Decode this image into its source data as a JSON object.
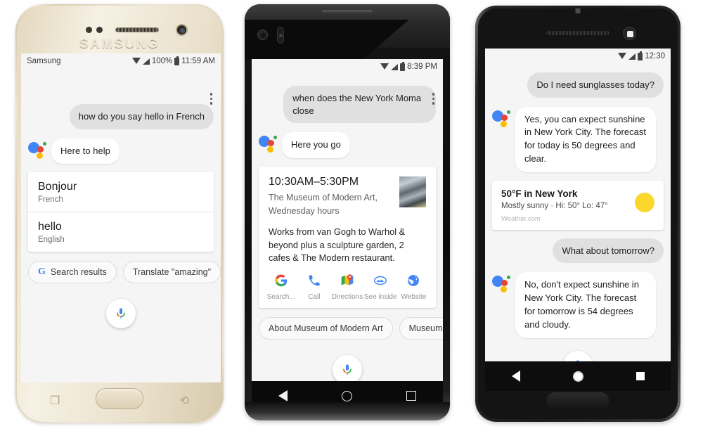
{
  "phones": {
    "left": {
      "device_label": "SAMSUNG",
      "statusbar": {
        "carrier": "Samsung",
        "battery": "100%",
        "time": "11:59 AM"
      },
      "conversation": {
        "user_query": "how do you say hello in French",
        "assistant_reply": "Here to help"
      },
      "translation_card": [
        {
          "word": "Bonjour",
          "language": "French"
        },
        {
          "word": "hello",
          "language": "English"
        }
      ],
      "chips": [
        {
          "icon": "google-g-icon",
          "label": "Search results"
        },
        {
          "icon": "",
          "label": "Translate \"amazing\""
        }
      ],
      "mic_label": "microphone"
    },
    "middle": {
      "statusbar": {
        "time": "8:39 PM"
      },
      "conversation": {
        "user_query": "when does the New York Moma close",
        "assistant_reply": "Here you go"
      },
      "place_card": {
        "hours": "10:30AM–5:30PM",
        "name": "The Museum of Modern Art,",
        "day_hours": "Wednesday hours",
        "description": "Works from van Gogh to Warhol & beyond plus a sculpture garden, 2 cafes & The Modern restaurant.",
        "actions": [
          {
            "icon": "google-g-icon",
            "label": "Search..."
          },
          {
            "icon": "phone-icon",
            "label": "Call"
          },
          {
            "icon": "maps-pin-icon",
            "label": "Directions"
          },
          {
            "icon": "see-inside-icon",
            "label": "See inside"
          },
          {
            "icon": "globe-icon",
            "label": "Website"
          }
        ]
      },
      "chips": [
        {
          "label": "About Museum of Modern Art"
        },
        {
          "label": "Museums i"
        }
      ],
      "mic_label": "microphone",
      "nav": {
        "back": "back",
        "home": "home",
        "recents": "recents"
      }
    },
    "right": {
      "statusbar": {
        "time": "12:30"
      },
      "conversation": [
        {
          "role": "user",
          "text": "Do I need sunglasses today?"
        },
        {
          "role": "assistant",
          "text": "Yes, you can expect sunshine in New York City. The forecast for today is 50 degrees and clear."
        },
        {
          "role": "user",
          "text": "What about tomorrow?"
        },
        {
          "role": "assistant",
          "text": "No, don't expect sunshine in New York City. The forecast for tomorrow is 54 degrees and cloudy."
        }
      ],
      "weather_card": {
        "title": "50°F in New York",
        "subtitle": "Mostly sunny · Hi: 50° Lo: 47°",
        "source": "Weather.com",
        "icon": "sun-icon"
      },
      "mic_label": "microphone",
      "nav": {
        "back": "back",
        "home": "home",
        "recents": "recents"
      }
    }
  },
  "colors": {
    "google_blue": "#4285F4",
    "google_red": "#EA4335",
    "google_yellow": "#FBBC05",
    "google_green": "#34A853",
    "sun_yellow": "#FBD72B",
    "user_bubble": "#E0E0E0",
    "screen_bg": "#F5F5F5"
  }
}
